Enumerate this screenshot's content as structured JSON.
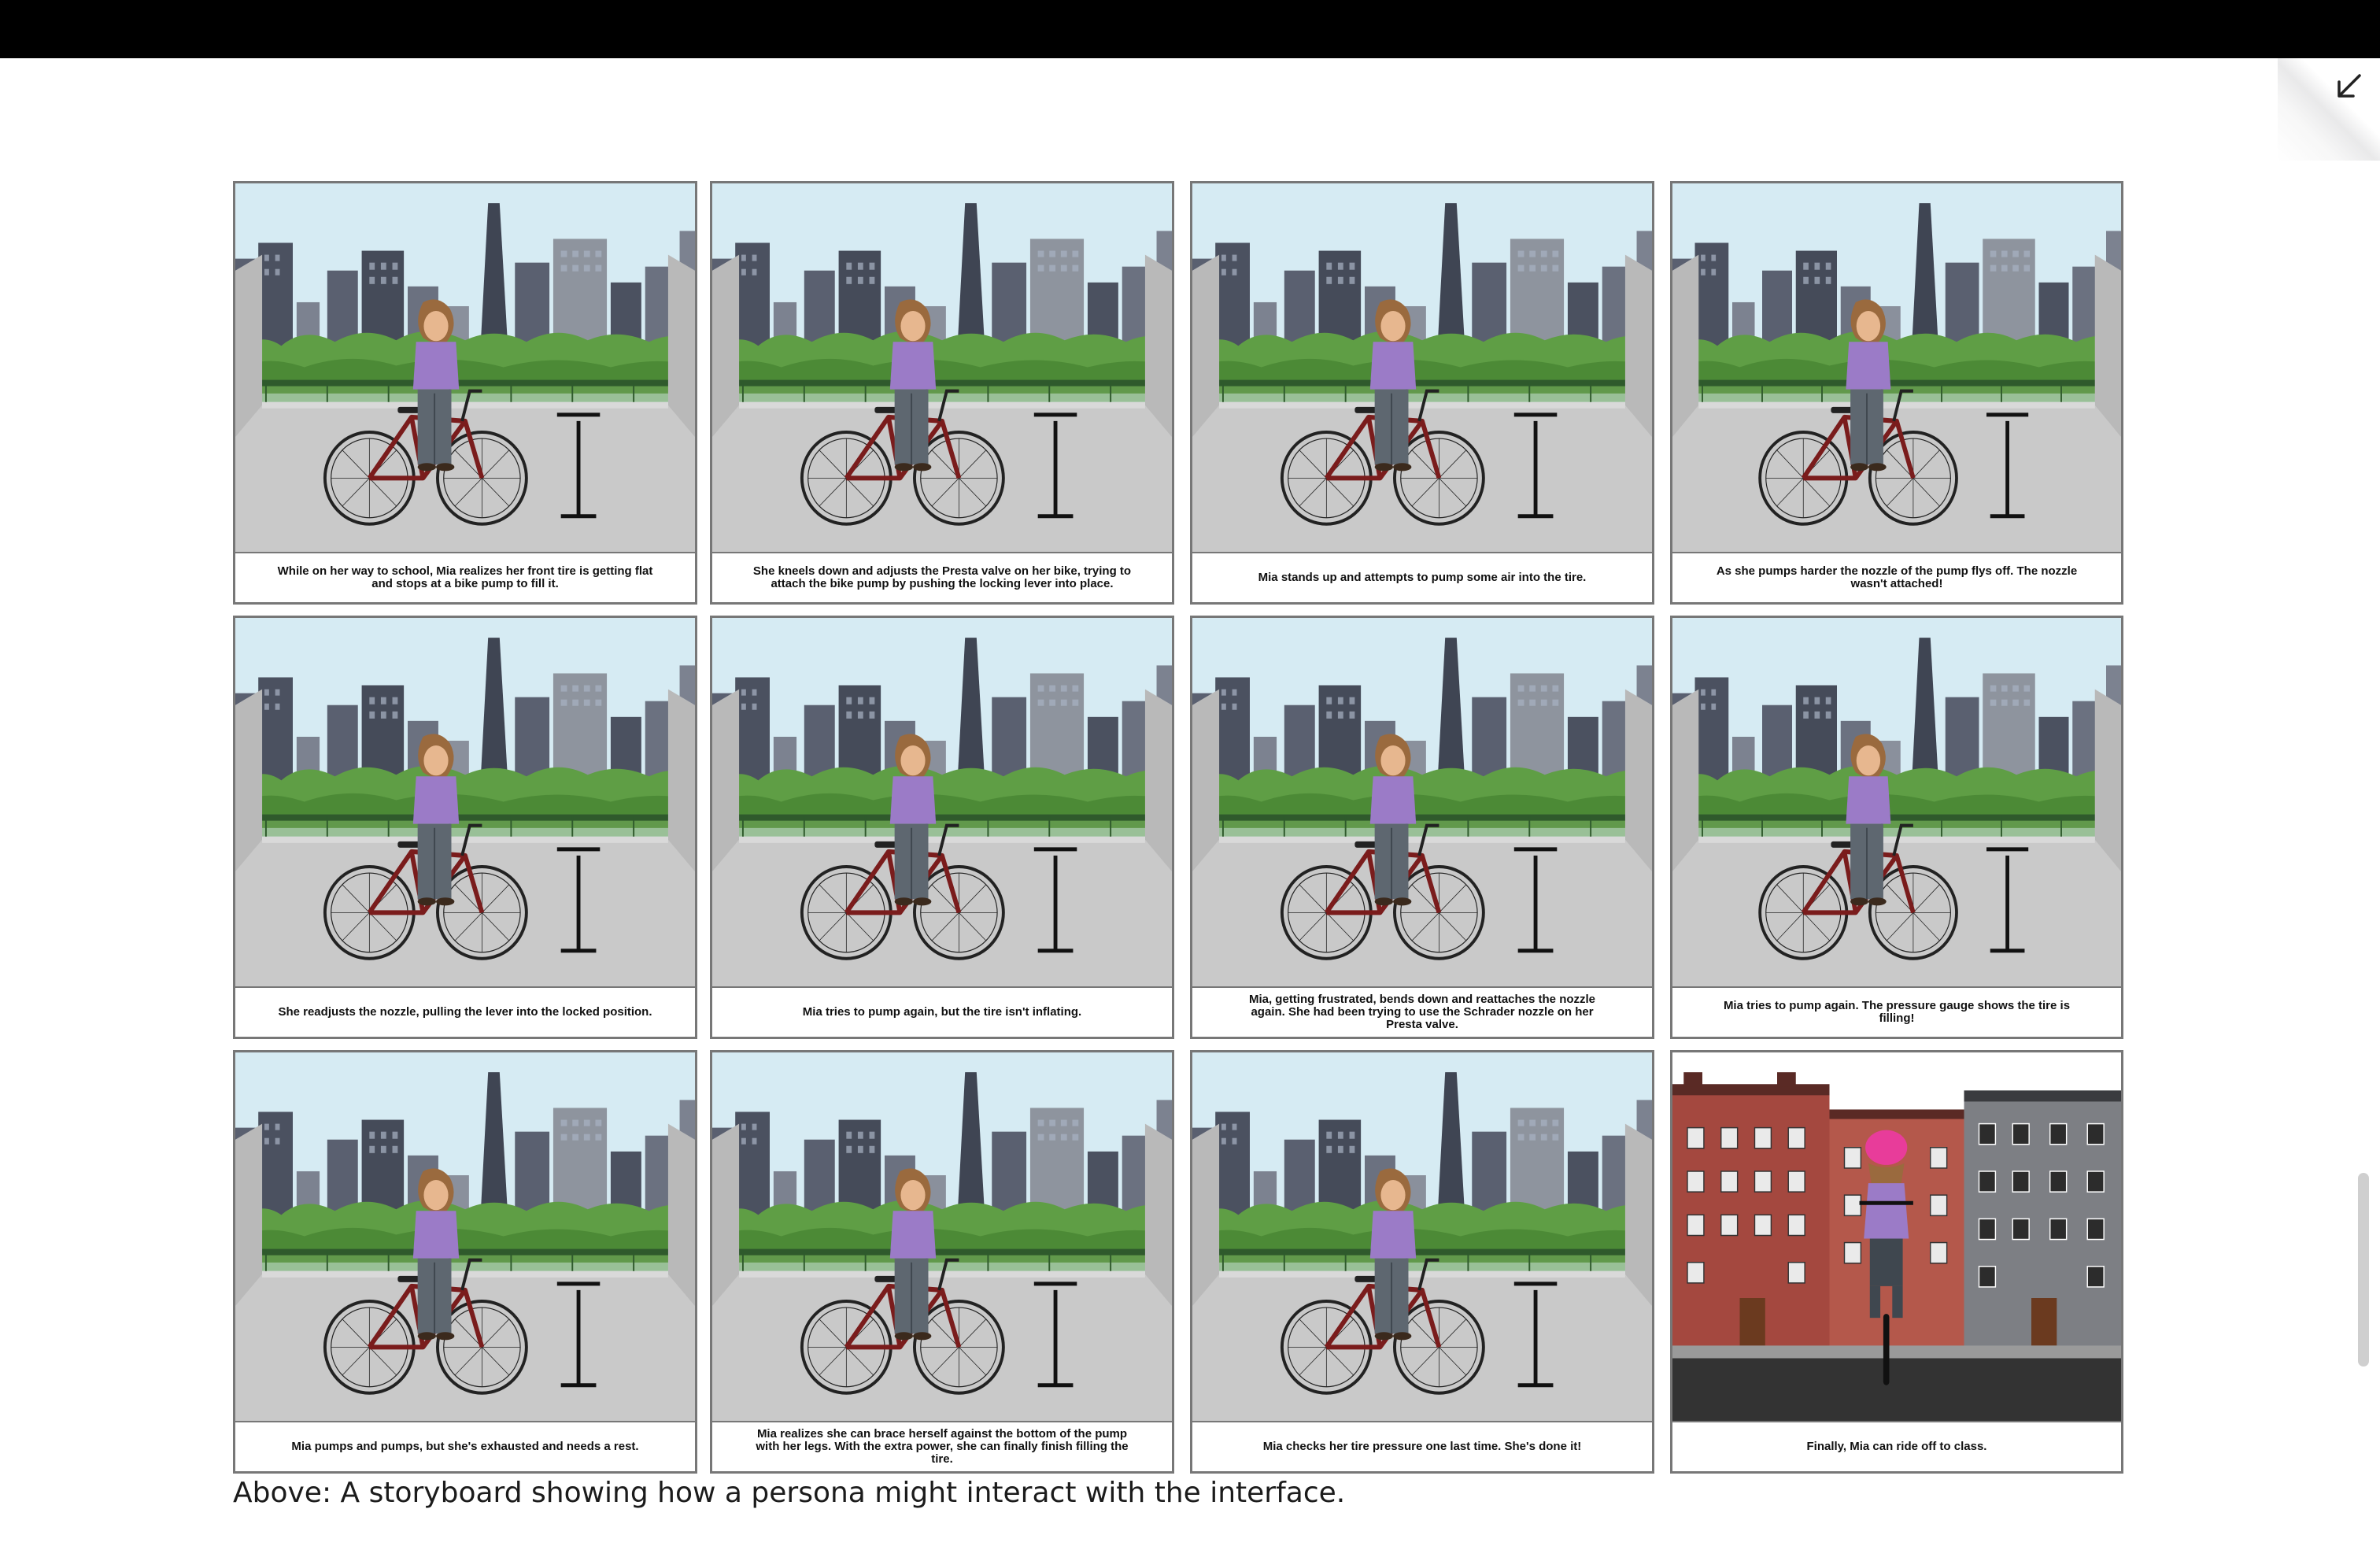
{
  "window": {
    "collapse_icon": "arrow-down-left-icon"
  },
  "storyboard": {
    "panels": [
      {
        "caption": "While on her way to school, Mia realizes her front tire is getting flat and stops at a bike pump to fill it.",
        "scene": "city-rooftop"
      },
      {
        "caption": "She kneels down and adjusts the Presta valve on her bike, trying to attach the bike pump by pushing the locking lever into place.",
        "scene": "city-rooftop"
      },
      {
        "caption": "Mia stands up and attempts to pump some air into the tire.",
        "scene": "city-rooftop"
      },
      {
        "caption": "As she pumps harder the nozzle of the pump flys off. The nozzle wasn't attached!",
        "scene": "city-rooftop"
      },
      {
        "caption": "She readjusts the nozzle, pulling the lever into the locked position.",
        "scene": "city-rooftop"
      },
      {
        "caption": "Mia tries to pump again, but the tire isn't inflating.",
        "scene": "city-rooftop"
      },
      {
        "caption": "Mia, getting frustrated, bends down and reattaches the nozzle again. She had been trying to use the Schrader nozzle on her Presta valve.",
        "scene": "city-rooftop"
      },
      {
        "caption": "Mia tries to pump again. The pressure gauge shows the tire is filling!",
        "scene": "city-rooftop"
      },
      {
        "caption": "Mia pumps and pumps, but she's exhausted and needs a rest.",
        "scene": "city-rooftop"
      },
      {
        "caption": "Mia realizes she can brace herself against the bottom of the pump with her legs. With the extra power, she can finally finish filling the tire.",
        "scene": "city-rooftop"
      },
      {
        "caption": "Mia checks her tire pressure one last time. She's done it!",
        "scene": "city-rooftop"
      },
      {
        "caption": "Finally, Mia can ride off to class.",
        "scene": "street"
      }
    ]
  },
  "footnote": "Above: A storyboard showing how a persona might interact with the interface.",
  "colors": {
    "sky": "#d6ebf3",
    "buildings_dark": "#4b5160",
    "buildings_mid": "#6b7180",
    "trees": "#5f9e45",
    "floor": "#c9c9c9",
    "bike_frame": "#7a1c1c",
    "shirt": "#9b7bc7",
    "hair": "#9a6a3e",
    "brick": "#a4483f",
    "asphalt": "#333333"
  }
}
